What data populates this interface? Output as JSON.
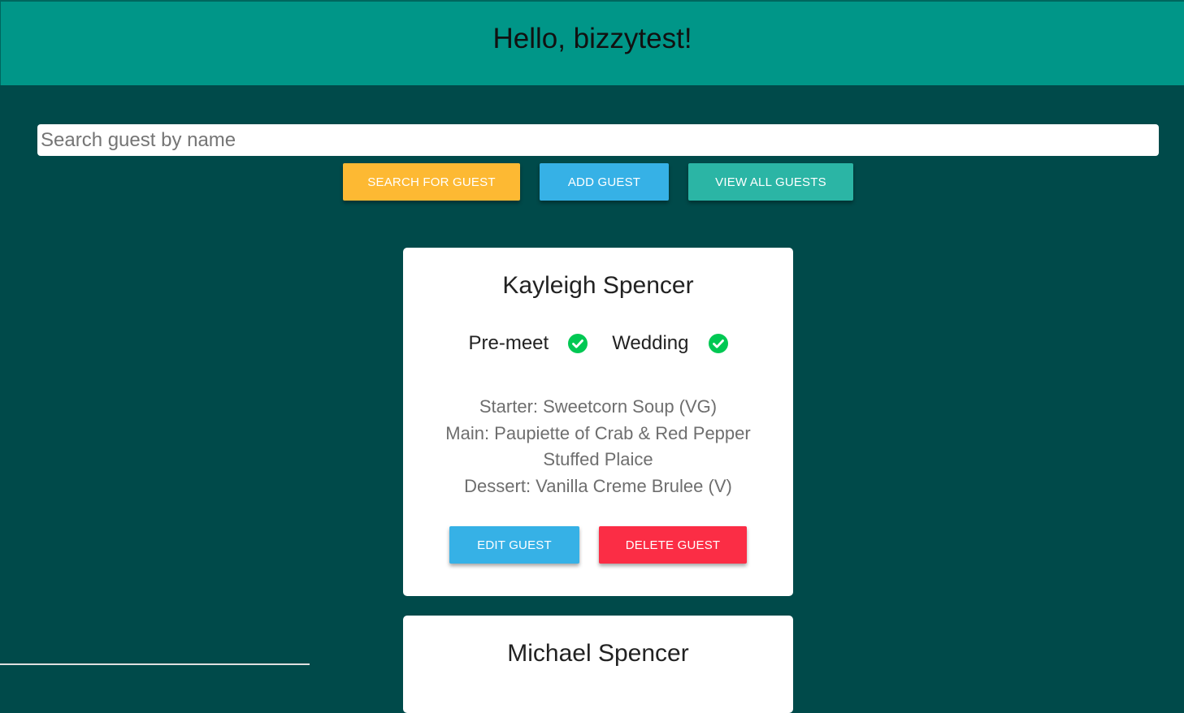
{
  "header": {
    "greeting": "Hello, bizzytest!"
  },
  "search": {
    "placeholder": "Search guest by name",
    "value": ""
  },
  "actions": {
    "search_label": "Search for guest",
    "add_label": "Add guest",
    "view_all_label": "View all guests"
  },
  "guests": [
    {
      "name": "Kayleigh Spencer",
      "events": [
        {
          "label": "Pre-meet",
          "status": "check-circle-icon"
        },
        {
          "label": "Wedding",
          "status": "check-circle-icon"
        }
      ],
      "menu": {
        "starter": "Starter: Sweetcorn Soup (VG)",
        "main": "Main: Paupiette of Crab & Red Pepper Stuffed Plaice",
        "dessert": "Dessert: Vanilla Creme Brulee (V)"
      },
      "edit_label": "Edit guest",
      "delete_label": "Delete guest"
    },
    {
      "name": "Michael Spencer"
    }
  ],
  "colors": {
    "background": "#004a4a",
    "header": "#009688",
    "search_button": "#fdb933",
    "add_button": "#36b1e6",
    "view_button": "#2bb5a5",
    "edit_button": "#36b1e6",
    "delete_button": "#fb2d45",
    "check": "#00c853"
  }
}
